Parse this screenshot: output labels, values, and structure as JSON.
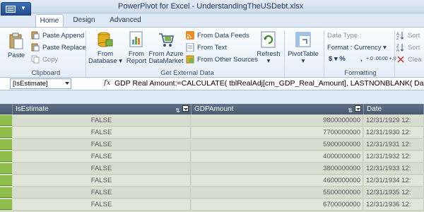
{
  "window": {
    "title": "PowerPivot for Excel - UnderstandingTheUSDebt.xlsx"
  },
  "tabs": [
    {
      "label": "Home",
      "active": true
    },
    {
      "label": "Design",
      "active": false
    },
    {
      "label": "Advanced",
      "active": false
    }
  ],
  "ribbon": {
    "clipboard": {
      "label": "Clipboard",
      "paste": "Paste",
      "paste_append": "Paste Append",
      "paste_replace": "Paste Replace",
      "copy": "Copy"
    },
    "external_data": {
      "label": "Get External Data",
      "from_database": [
        "From",
        "Database ▾"
      ],
      "from_report": [
        "From",
        "Report"
      ],
      "from_azure": [
        "From Azure",
        "DataMarket"
      ],
      "from_data_feeds": "From Data Feeds",
      "from_text": "From Text",
      "from_other_sources": "From Other Sources",
      "refresh": [
        "Refresh",
        "▾"
      ]
    },
    "pivottable": [
      "PivotTable",
      "▾"
    ],
    "formatting": {
      "label": "Formatting",
      "data_type": "Data Type :",
      "format": "Format : Currency ▾",
      "currency": "$ ▾ %",
      "comma": ",",
      "increase_decimal": "+.0 .00",
      "decrease_decimal": ".00 +.0"
    },
    "sort": {
      "sort1": "Sort",
      "sort2": "Sort",
      "clear": "Clea"
    }
  },
  "formula_bar": {
    "name_box": "[IsEstimate]",
    "fx": "fx",
    "formula": "GDP Real Amount:=CALCULATE( tblRealAdj[cm_GDP_Real_Amount],  LASTNONBLANK( Da"
  },
  "table": {
    "columns": [
      "IsEstimate",
      "GDPAmount",
      "Date"
    ],
    "rows": [
      [
        "FALSE",
        "9800000000",
        "12/31/1929 12:"
      ],
      [
        "FALSE",
        "7700000000",
        "12/31/1930 12:"
      ],
      [
        "FALSE",
        "5900000000",
        "12/31/1931 12:"
      ],
      [
        "FALSE",
        "4000000000",
        "12/31/1932 12:"
      ],
      [
        "FALSE",
        "3800000000",
        "12/31/1933 12:"
      ],
      [
        "FALSE",
        "4600000000",
        "12/31/1934 12:"
      ],
      [
        "FALSE",
        "5500000000",
        "12/31/1935 12:"
      ],
      [
        "FALSE",
        "6700000000",
        "12/31/1936 12:"
      ]
    ]
  },
  "colors": {
    "header_bg": "#4a5a70",
    "row_selector": "#8fbf4a",
    "ribbon_bg": "#e6eef8"
  }
}
